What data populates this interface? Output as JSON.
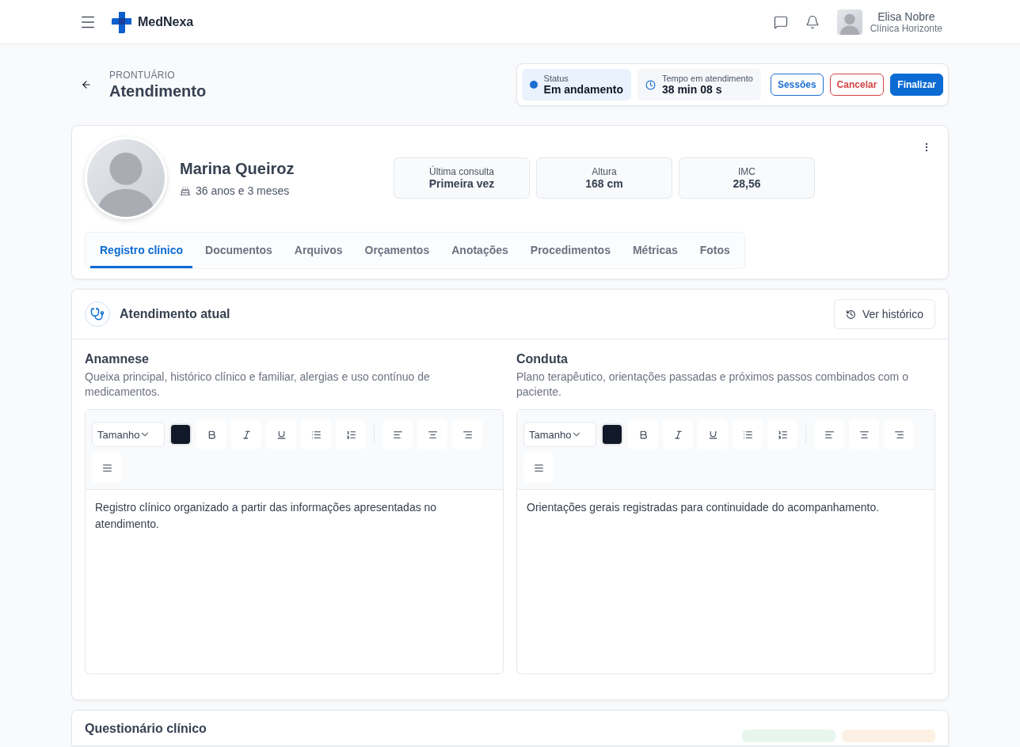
{
  "header": {
    "brand": "MedNexa",
    "user": {
      "name": "Elisa Nobre",
      "clinic": "Clínica Horizonte"
    }
  },
  "page": {
    "eyebrow": "PRONTUÁRIO",
    "title": "Atendimento",
    "status": {
      "label": "Status",
      "value": "Em andamento"
    },
    "timer": {
      "label": "Tempo em atendimento",
      "value": "38 min 08 s"
    },
    "actions": [
      {
        "label": "Sessões",
        "kind": "outline"
      },
      {
        "label": "Cancelar",
        "kind": "danger"
      },
      {
        "label": "Finalizar",
        "kind": "primary"
      }
    ]
  },
  "patient": {
    "name": "Marina Queiroz",
    "age": "36 anos e 3 meses",
    "stats": [
      {
        "label": "Última consulta",
        "value": "Primeira vez"
      },
      {
        "label": "Altura",
        "value": "168 cm"
      },
      {
        "label": "IMC",
        "value": "28,56"
      }
    ],
    "tabs": [
      {
        "label": "Registro clínico",
        "selected": true
      },
      {
        "label": "Documentos",
        "selected": false
      },
      {
        "label": "Arquivos",
        "selected": false
      },
      {
        "label": "Orçamentos",
        "selected": false
      },
      {
        "label": "Anotações",
        "selected": false
      },
      {
        "label": "Procedimentos",
        "selected": false
      },
      {
        "label": "Métricas",
        "selected": false
      },
      {
        "label": "Fotos",
        "selected": false
      }
    ]
  },
  "current": {
    "title": "Atendimento atual",
    "history_button": "Ver histórico",
    "editors": [
      {
        "title": "Anamnese",
        "description": "Queixa principal, histórico clínico e familiar, alergias e uso contínuo de medicamentos.",
        "size_label": "Tamanho",
        "content": "Registro clínico organizado a partir das informações apresentadas no atendimento."
      },
      {
        "title": "Conduta",
        "description": "Plano terapêutico, orientações passadas e próximos passos combinados com o paciente.",
        "size_label": "Tamanho",
        "content": "Orientações gerais registradas para continuidade do acompanhamento."
      }
    ]
  },
  "questionnaire": {
    "title": "Questionário clínico"
  }
}
